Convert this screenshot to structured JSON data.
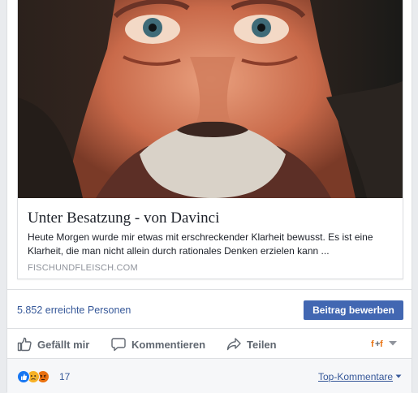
{
  "link": {
    "title": "Unter Besatzung - von Davinci",
    "description": "Heute Morgen wurde mir etwas mit erschreckender Klarheit bewusst. Es ist eine Klarheit, die man nicht allein durch rationales Denken erzielen kann ...",
    "domain": "FISCHUNDFLEISCH.COM"
  },
  "insights": {
    "reach_text": "5.852 erreichte Personen",
    "boost_label": "Beitrag bewerben"
  },
  "actions": {
    "like": "Gefällt mir",
    "comment": "Kommentieren",
    "share": "Teilen"
  },
  "reactions": {
    "types": [
      "like-icon",
      "sad-icon",
      "angry-icon"
    ],
    "count": "17",
    "sort_label": "Top-Kommentare"
  },
  "colors": {
    "link_blue": "#365899",
    "button_blue": "#4267b2",
    "action_gray": "#606770",
    "like_blue": "#1877f2",
    "sad_yellow": "#f7b125",
    "angry_red": "#e9710f"
  }
}
